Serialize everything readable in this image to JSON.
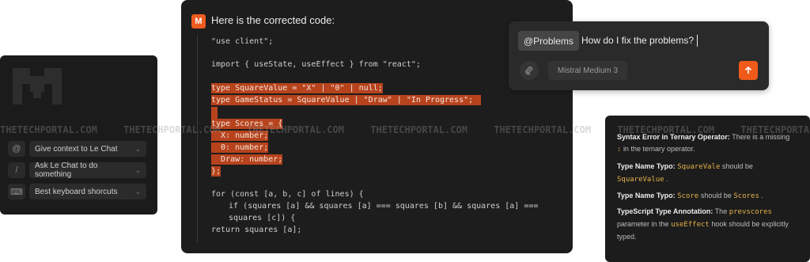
{
  "left_panel": {
    "rows": [
      {
        "key": "@",
        "label": "Give context to Le Chat"
      },
      {
        "key": "/",
        "label": "Ask Le Chat to do something"
      },
      {
        "key": "⌨",
        "label": "Best keyboard shorcuts"
      }
    ]
  },
  "code_panel": {
    "title": "Here is the corrected code:",
    "logo_letter": "M",
    "lines": [
      "\"use client\";",
      "",
      "import { useState, useEffect } from \"react\";",
      "",
      "type SquareValue = \"X\" | \"0\" | null;",
      "type GameStatus = SquareValue | \"Draw\" | \"In Progress\";",
      "",
      "type Scores = {",
      "  X: number;",
      "  0: number;",
      "  Draw: number;",
      "};",
      "",
      "for (const [a, b, c] of lines) {",
      "  if (squares [a] && squares [a] === squares [b] && squares [a] ===",
      "  squares [c]) {",
      "return squares [a];"
    ]
  },
  "prompt_panel": {
    "tag": "@Problems",
    "text": "How do I fix the problems?",
    "model": "Mistral Medium 3"
  },
  "errors_panel": {
    "e1_title": "Syntax Error in Ternary Operator:",
    "e1_text": "There is a missing",
    "e1_code": ":",
    "e1_text2": "in the ternary operator.",
    "e2_title": "Type Name Typo:",
    "e2_code1": "SquareVale",
    "e2_text": "should be",
    "e2_code2": "SquareValue",
    "e3_title": "Type Name Typo:",
    "e3_code1": "Score",
    "e3_text": "should be",
    "e3_code2": "Scores",
    "e4_title": "TypeScript Type Annotation:",
    "e4_text": "The",
    "e4_code1": "prevscores",
    "e4_text2": "parameter in the",
    "e4_code2": "useEffect",
    "e4_text3": "hook should be explicitly typed."
  },
  "watermark": "THETECHPORTAL.COM",
  "colors": {
    "accent": "#f05a1a",
    "highlight": "#b7431d"
  }
}
